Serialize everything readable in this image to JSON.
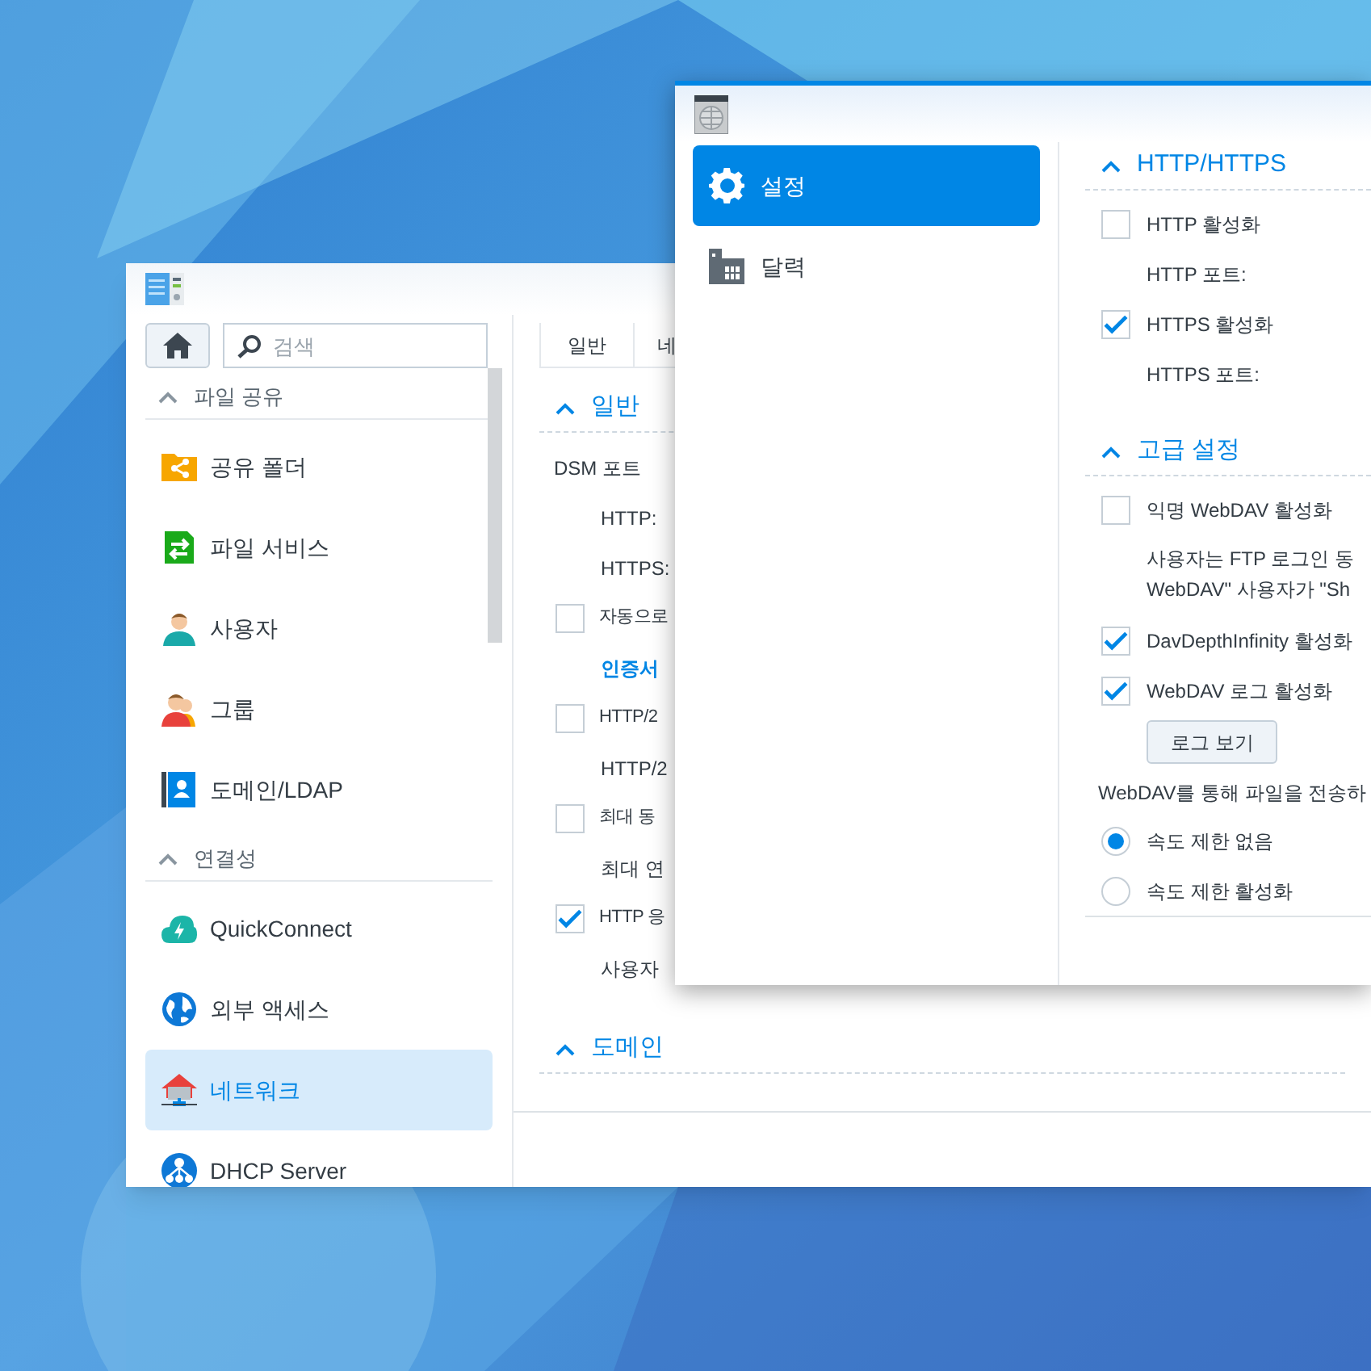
{
  "back_window": {
    "sidebar": {
      "search": {
        "placeholder": "검색"
      },
      "groups": [
        {
          "title": "파일 공유",
          "items": [
            {
              "label": "공유 폴더",
              "selected": false
            },
            {
              "label": "파일 서비스",
              "selected": false
            },
            {
              "label": "사용자",
              "selected": false
            },
            {
              "label": "그룹",
              "selected": false
            },
            {
              "label": "도메인/LDAP",
              "selected": false
            }
          ]
        },
        {
          "title": "연결성",
          "items": [
            {
              "label": "QuickConnect",
              "selected": false
            },
            {
              "label": "외부 액세스",
              "selected": false
            },
            {
              "label": "네트워크",
              "selected": true
            },
            {
              "label": "DHCP Server",
              "selected": false
            }
          ]
        }
      ]
    },
    "tabs": [
      "일반",
      "네"
    ],
    "sections": [
      {
        "title": "일반",
        "rows": [
          {
            "kind": "heading",
            "label": "DSM 포트"
          },
          {
            "kind": "field_label",
            "label": "HTTP:"
          },
          {
            "kind": "field_label",
            "label": "HTTPS:"
          },
          {
            "kind": "checkbox",
            "label": "자동으로",
            "checked": false
          },
          {
            "kind": "link",
            "label": "인증서"
          },
          {
            "kind": "checkbox",
            "label": "HTTP/2",
            "checked": false
          },
          {
            "kind": "field_label",
            "label": "HTTP/2"
          },
          {
            "kind": "checkbox",
            "label": "최대 동",
            "checked": false
          },
          {
            "kind": "field_label",
            "label": "최대 연"
          },
          {
            "kind": "checkbox",
            "label": "HTTP 응",
            "checked": true
          },
          {
            "kind": "field_label",
            "label": "사용자"
          }
        ]
      },
      {
        "title": "도메인"
      }
    ]
  },
  "front_window": {
    "sidebar": [
      {
        "label": "설정",
        "selected": true
      },
      {
        "label": "달력",
        "selected": false
      }
    ],
    "sections": [
      {
        "title": "HTTP/HTTPS",
        "rows": [
          {
            "kind": "checkbox",
            "label": "HTTP 활성화",
            "checked": false
          },
          {
            "kind": "field_label",
            "label": "HTTP 포트:"
          },
          {
            "kind": "checkbox",
            "label": "HTTPS 활성화",
            "checked": true
          },
          {
            "kind": "field_label",
            "label": "HTTPS 포트:"
          }
        ]
      },
      {
        "title": "고급 설정",
        "rows": [
          {
            "kind": "checkbox",
            "label": "익명 WebDAV 활성화",
            "checked": false
          },
          {
            "kind": "note",
            "lines": [
              "사용자는 FTP 로그인 동",
              "WebDAV\" 사용자가 \"Sh"
            ]
          },
          {
            "kind": "checkbox",
            "label": "DavDepthInfinity 활성화",
            "checked": true
          },
          {
            "kind": "checkbox",
            "label": "WebDAV 로그 활성화",
            "checked": true
          },
          {
            "kind": "button",
            "label": "로그 보기"
          },
          {
            "kind": "text",
            "label": "WebDAV를 통해 파일을 전송하"
          },
          {
            "kind": "radio",
            "label": "속도 제한 없음",
            "selected": true
          },
          {
            "kind": "radio",
            "label": "속도 제한 활성화",
            "selected": false
          }
        ]
      }
    ]
  }
}
